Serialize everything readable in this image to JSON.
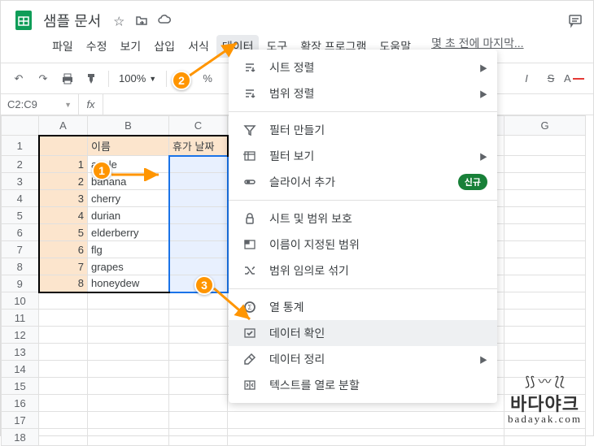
{
  "doc": {
    "title": "샘플 문서"
  },
  "menubar": {
    "items": [
      "파일",
      "수정",
      "보기",
      "삽입",
      "서식",
      "데이터",
      "도구",
      "확장 프로그램",
      "도움말"
    ],
    "last_edit": "몇 초 전에 마지막..."
  },
  "toolbar": {
    "zoom": "100%"
  },
  "namebox": "C2:C9",
  "columns": [
    "A",
    "B",
    "C",
    "G"
  ],
  "header_row": {
    "b": "이름",
    "c": "휴가 날짜"
  },
  "rows": [
    {
      "n": "1",
      "a": "",
      "b": "",
      "c": ""
    },
    {
      "n": "2",
      "a": "1",
      "b": "apple",
      "c": ""
    },
    {
      "n": "3",
      "a": "2",
      "b": "banana",
      "c": ""
    },
    {
      "n": "4",
      "a": "3",
      "b": "cherry",
      "c": ""
    },
    {
      "n": "5",
      "a": "4",
      "b": "durian",
      "c": ""
    },
    {
      "n": "6",
      "a": "5",
      "b": "elderberry",
      "c": ""
    },
    {
      "n": "7",
      "a": "6",
      "b": "flg",
      "c": ""
    },
    {
      "n": "8",
      "a": "7",
      "b": "grapes",
      "c": ""
    },
    {
      "n": "9",
      "a": "8",
      "b": "honeydew",
      "c": ""
    }
  ],
  "empty_rows": [
    "10",
    "11",
    "12",
    "13",
    "14",
    "15",
    "16",
    "17",
    "18"
  ],
  "dropdown": {
    "groups": [
      [
        {
          "icon": "sort",
          "label": "시트 정렬",
          "sub": true
        },
        {
          "icon": "sort",
          "label": "범위 정렬",
          "sub": true
        }
      ],
      [
        {
          "icon": "filter",
          "label": "필터 만들기"
        },
        {
          "icon": "filter-view",
          "label": "필터 보기",
          "sub": true
        },
        {
          "icon": "slicer",
          "label": "슬라이서 추가",
          "badge": "신규"
        }
      ],
      [
        {
          "icon": "lock",
          "label": "시트 및 범위 보호"
        },
        {
          "icon": "named",
          "label": "이름이 지정된 범위"
        },
        {
          "icon": "shuffle",
          "label": "범위 임의로 섞기"
        }
      ],
      [
        {
          "icon": "stats",
          "label": "열 통계"
        },
        {
          "icon": "check",
          "label": "데이터 확인",
          "hl": true
        },
        {
          "icon": "clean",
          "label": "데이터 정리",
          "sub": true
        },
        {
          "icon": "split",
          "label": "텍스트를 열로 분할"
        }
      ]
    ]
  },
  "markers": {
    "1": "1",
    "2": "2",
    "3": "3"
  },
  "watermark": {
    "main": "바다야크",
    "sub": "badayak.com"
  }
}
